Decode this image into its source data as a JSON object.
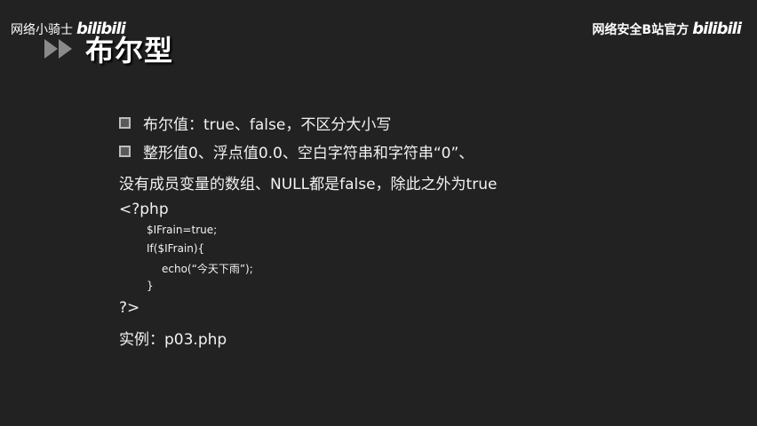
{
  "watermark": {
    "left_text": "网络小骑士",
    "left_logo": "bilibili",
    "right_text": "网络安全B站官方",
    "right_logo": "bilibili"
  },
  "slide": {
    "title": "布尔型",
    "bullets": [
      "布尔值：true、false，不区分大小写",
      "整形值0、浮点值0.0、空白字符串和字符串“0”、"
    ],
    "continuation": "没有成员变量的数组、NULL都是false，除此之外为true",
    "code": {
      "open_tag": "<?php",
      "line1": "$IFrain=true;",
      "line2": "If($IFrain){",
      "line3": "echo(“今天下雨”);",
      "line4": "}",
      "close_tag": "?>"
    },
    "example": "实例：p03.php"
  },
  "colors": {
    "background": "#222222",
    "text": "#f2f2f2",
    "arrow": "#8a8a8a"
  },
  "icons": [
    "play-arrows-icon",
    "bullet-square-icon"
  ]
}
